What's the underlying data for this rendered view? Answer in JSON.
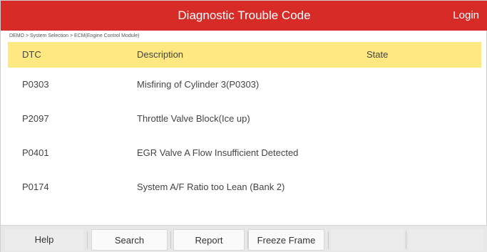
{
  "header": {
    "title": "Diagnostic Trouble Code",
    "login_label": "Login",
    "background_color": "#d62b27"
  },
  "breadcrumb": "DEMO > System Selection > ECM(Engine Control Module)",
  "table": {
    "header_color": "#fde882",
    "columns": [
      "DTC",
      "Description",
      "State"
    ],
    "rows": [
      {
        "dtc": "P0303",
        "description": "Misfiring of Cylinder 3(P0303)",
        "state": ""
      },
      {
        "dtc": "P2097",
        "description": "Throttle Valve Block(Ice up)",
        "state": ""
      },
      {
        "dtc": "P0401",
        "description": "EGR Valve A Flow Insufficient Detected",
        "state": ""
      },
      {
        "dtc": "P0174",
        "description": "System A/F Ratio too Lean (Bank 2)",
        "state": ""
      }
    ]
  },
  "footer": {
    "buttons": [
      "Help",
      "Search",
      "Report",
      "Freeze Frame",
      "",
      ""
    ]
  }
}
